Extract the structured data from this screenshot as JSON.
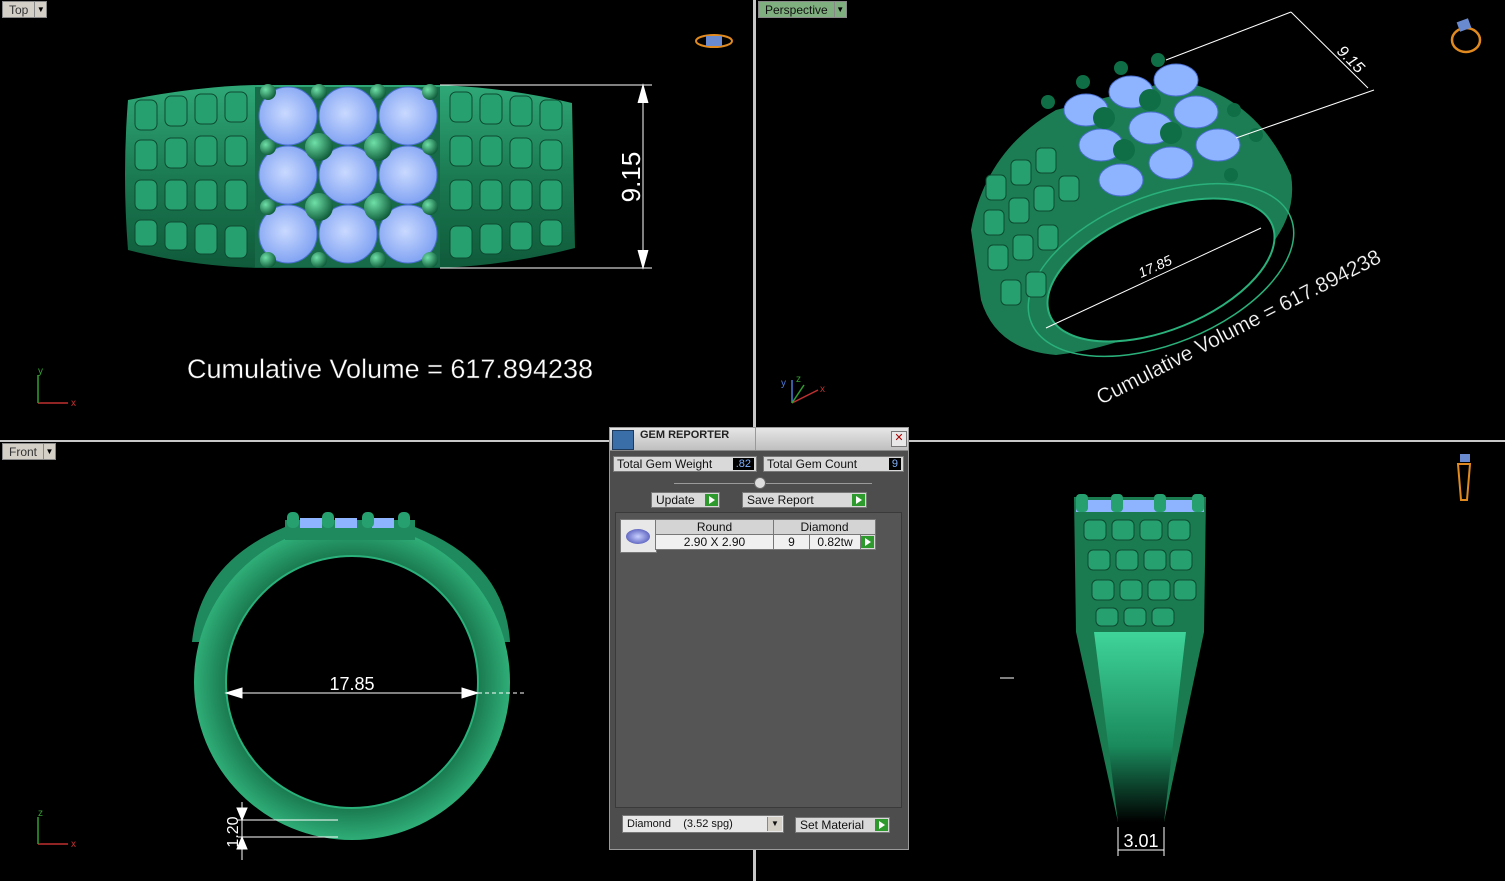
{
  "viewports": {
    "top": {
      "label": "Top",
      "dimension": "9.15",
      "volume_text": "Cumulative Volume = 617.894238",
      "axis_v": "y",
      "axis_h": "x"
    },
    "perspective": {
      "label": "Perspective",
      "dimension_top": "9.15",
      "dimension_inner": "17.85",
      "volume_text": "Cumulative Volume = 617.894238",
      "axis_v": "z",
      "axis_h": "x",
      "axis_y": "y"
    },
    "front": {
      "label": "Front",
      "inner_diameter": "17.85",
      "thickness": "1.20",
      "axis_v": "z",
      "axis_h": "x"
    },
    "side": {
      "shank_width": "3.01"
    }
  },
  "gem_reporter": {
    "title": "GEM REPORTER",
    "total_weight_label": "Total Gem Weight",
    "total_weight_value": ".82",
    "total_count_label": "Total Gem Count",
    "total_count_value": "9",
    "update_label": "Update",
    "save_report_label": "Save Report",
    "gems": [
      {
        "shape": "Round",
        "material": "Diamond",
        "size": "2.90 X 2.90",
        "count": "9",
        "weight": "0.82tw"
      }
    ],
    "material_select": "Diamond    (3.52 spg)",
    "set_material_label": "Set Material"
  },
  "colors": {
    "metal": "#1f8a5e",
    "gem": "#8fb4ff",
    "dimension": "#ffffff",
    "axis_red": "#c03030",
    "axis_green": "#30a030"
  }
}
